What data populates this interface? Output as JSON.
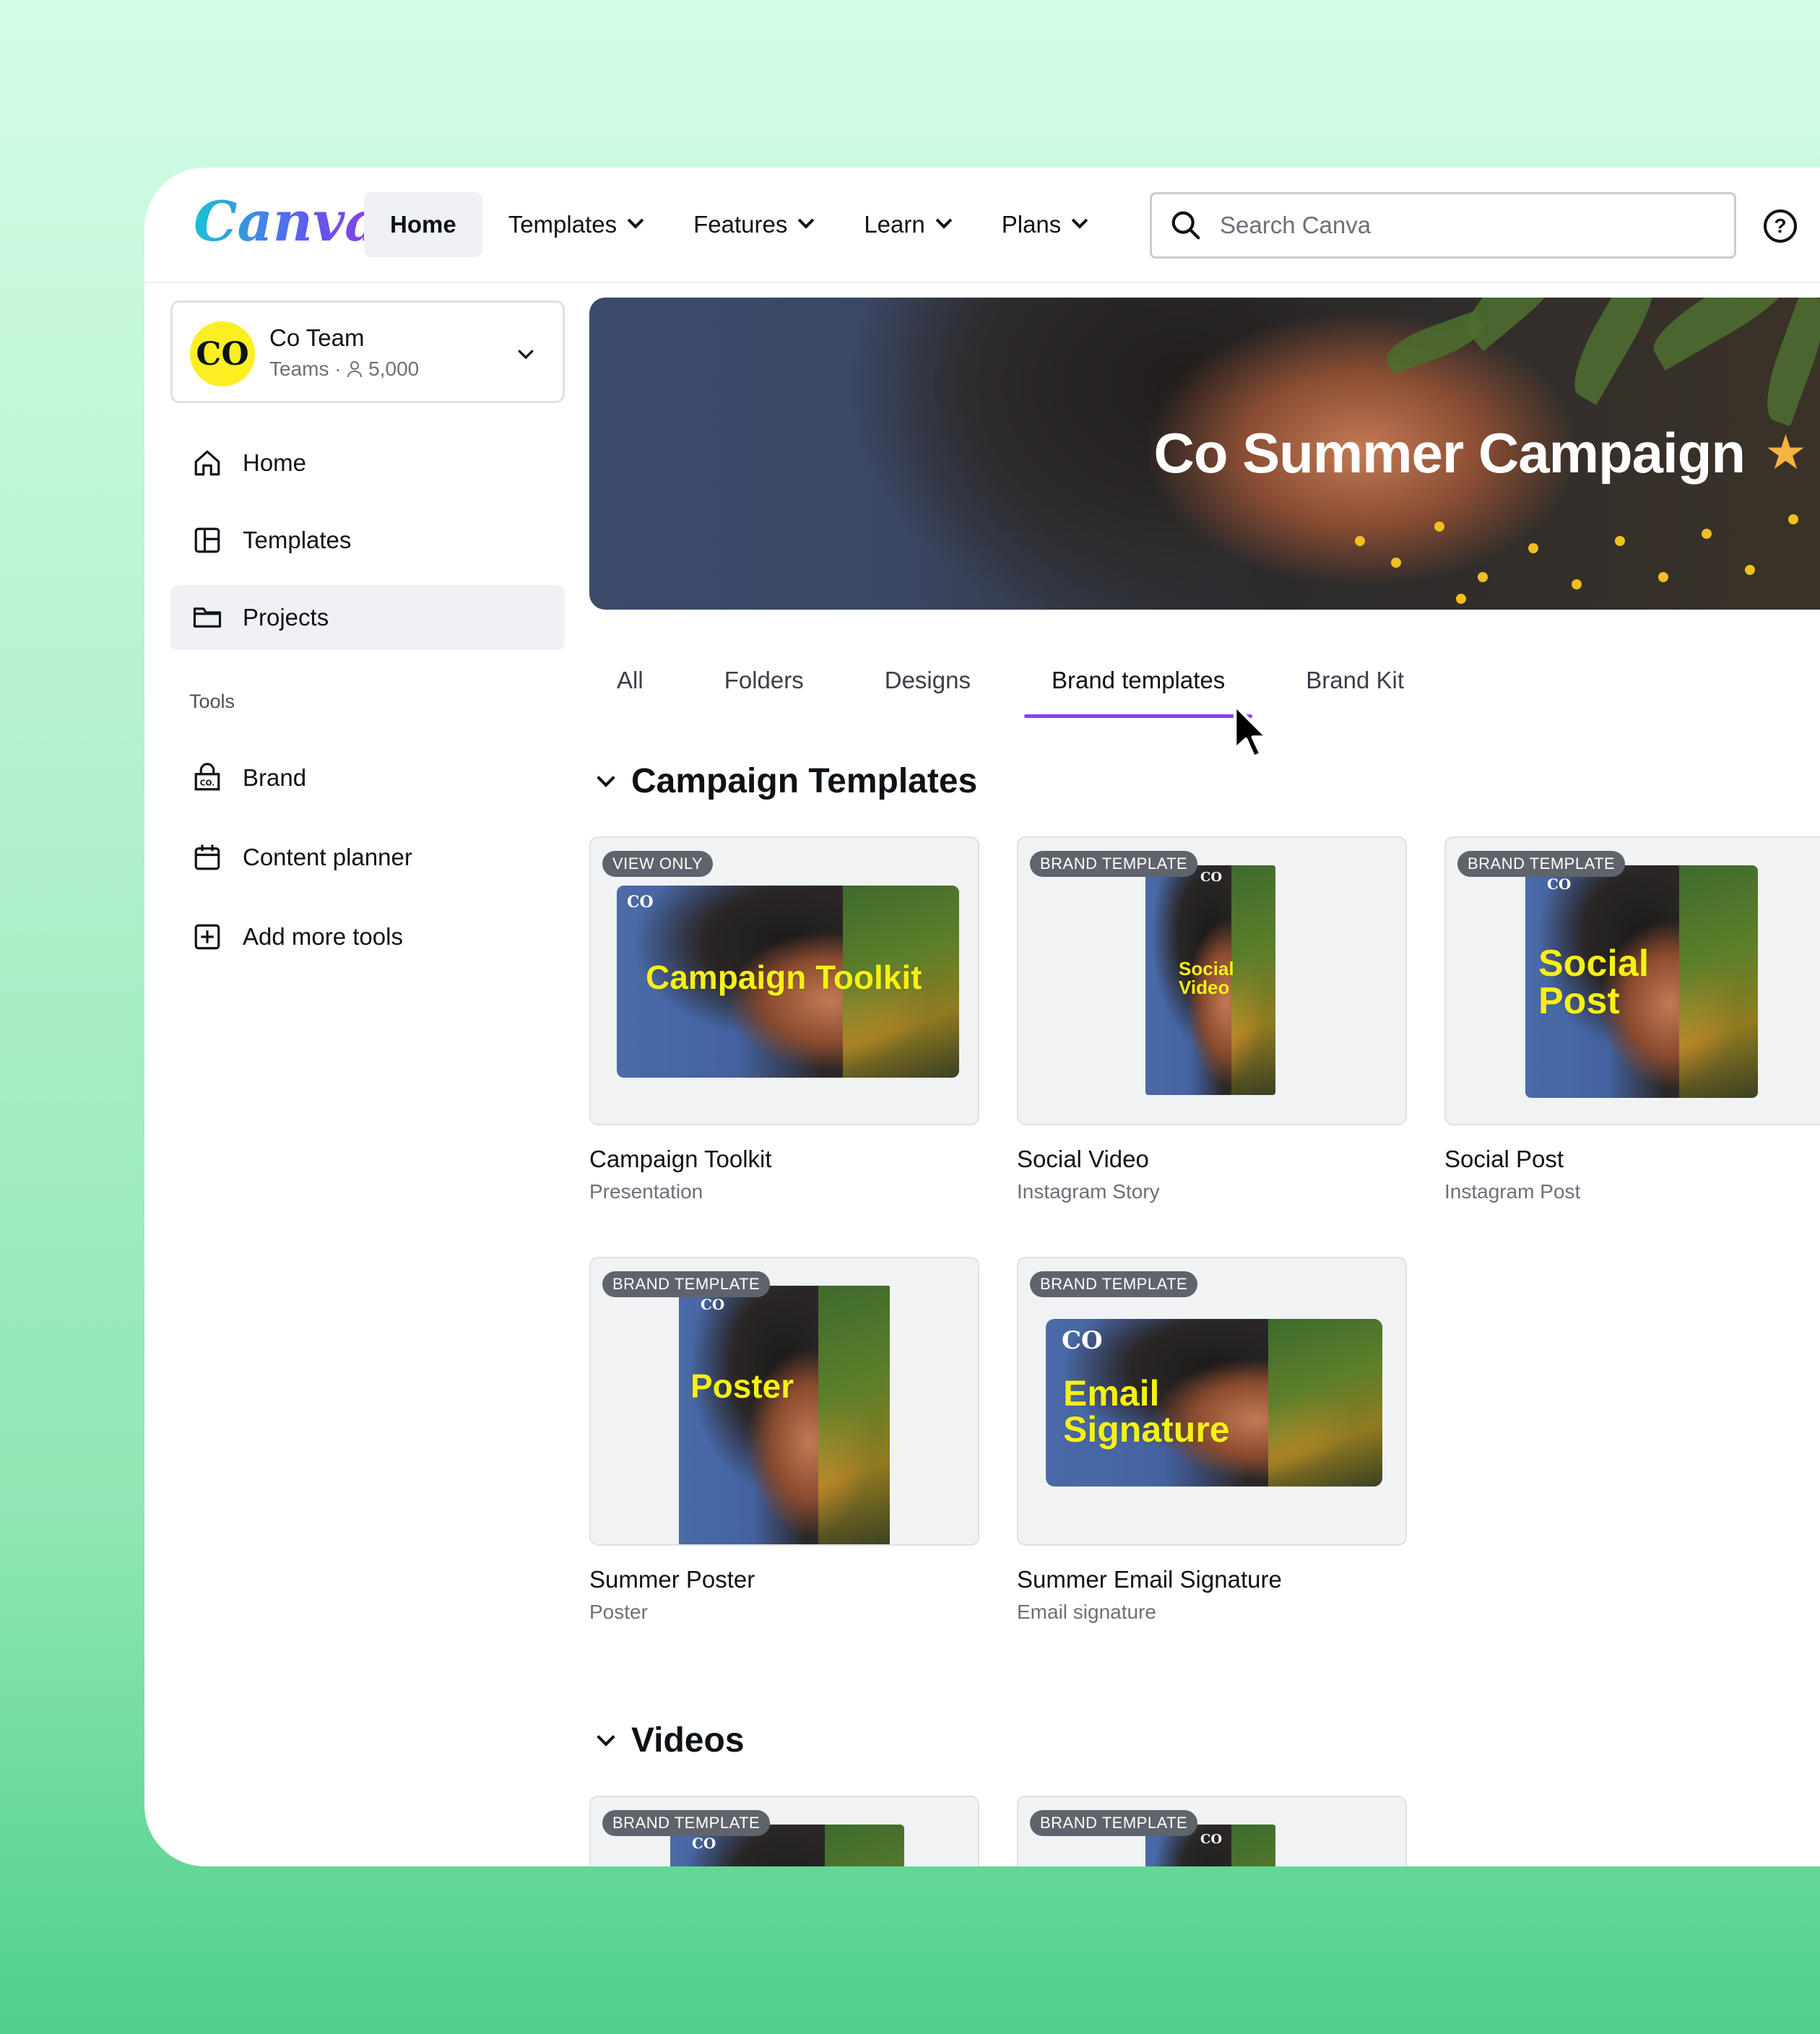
{
  "brand": {
    "logo_text": "Canva"
  },
  "nav": {
    "items": [
      {
        "label": "Home",
        "active": true,
        "dropdown": false
      },
      {
        "label": "Templates",
        "active": false,
        "dropdown": true
      },
      {
        "label": "Features",
        "active": false,
        "dropdown": true
      },
      {
        "label": "Learn",
        "active": false,
        "dropdown": true
      },
      {
        "label": "Plans",
        "active": false,
        "dropdown": true
      }
    ],
    "search_placeholder": "Search Canva",
    "help_icon": "question-mark-icon"
  },
  "team": {
    "avatar_text": "CO",
    "name": "Co Team",
    "plan": "Teams",
    "members": "5,000"
  },
  "sidebar": {
    "items": [
      {
        "label": "Home",
        "icon": "home-icon"
      },
      {
        "label": "Templates",
        "icon": "templates-icon"
      },
      {
        "label": "Projects",
        "icon": "folder-icon",
        "active": true
      }
    ],
    "tools_heading": "Tools",
    "tools": [
      {
        "label": "Brand",
        "icon": "brand-kit-icon"
      },
      {
        "label": "Content planner",
        "icon": "calendar-icon"
      },
      {
        "label": "Add more tools",
        "icon": "add-square-icon"
      }
    ]
  },
  "banner": {
    "title": "Co Summer Campaign",
    "star_icon": "star-icon",
    "star_color": "#f5b342"
  },
  "tabs": {
    "items": [
      "All",
      "Folders",
      "Designs",
      "Brand templates",
      "Brand Kit"
    ],
    "active_index": 3,
    "accent": "#8b3dff"
  },
  "sections": [
    {
      "title": "Campaign Templates",
      "cards": [
        {
          "badge": "VIEW ONLY",
          "thumb_text": "Campaign Toolkit",
          "title": "Campaign Toolkit",
          "subtitle": "Presentation"
        },
        {
          "badge": "BRAND TEMPLATE",
          "thumb_text": "Social Video",
          "title": "Social Video",
          "subtitle": "Instagram Story"
        },
        {
          "badge": "BRAND TEMPLATE",
          "thumb_text": "Social Post",
          "title": "Social Post",
          "subtitle": "Instagram Post"
        },
        {
          "badge": "BRAND TEMPLATE",
          "thumb_text": "Poster",
          "title": "Summer Poster",
          "subtitle": "Poster"
        },
        {
          "badge": "BRAND TEMPLATE",
          "thumb_text": "Email Signature",
          "title": "Summer Email Signature",
          "subtitle": "Email signature"
        }
      ]
    },
    {
      "title": "Videos",
      "cards": [
        {
          "badge": "BRAND TEMPLATE"
        },
        {
          "badge": "BRAND TEMPLATE"
        }
      ]
    }
  ],
  "thumb_logo": "CO",
  "thumb_text_color": "#f6f014"
}
